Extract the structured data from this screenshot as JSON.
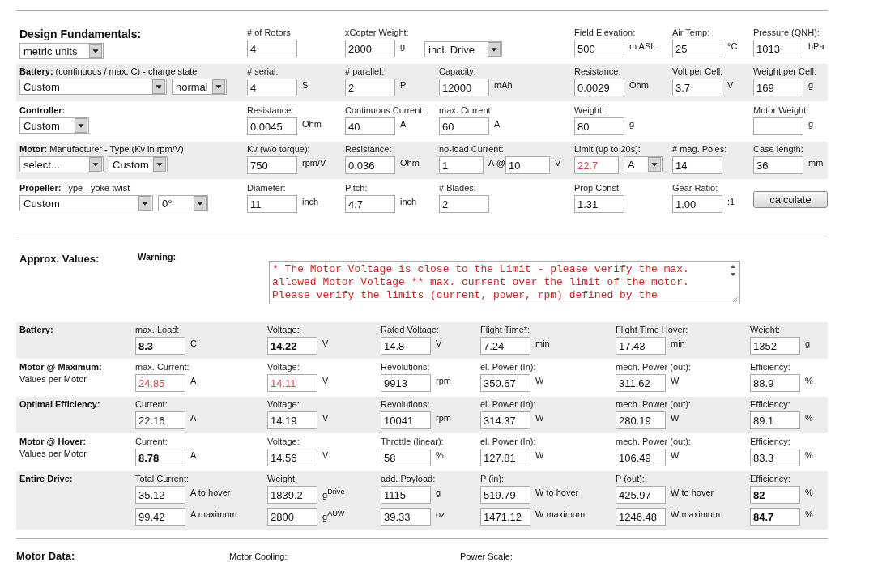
{
  "setup": {
    "rows": [
      {
        "kind": "title",
        "title": "Design Fundamentals:",
        "selects": [
          {
            "value": "metric units"
          }
        ],
        "cells": [
          {
            "label": "# of Rotors",
            "fields": [
              {
                "value": "4"
              }
            ]
          },
          {
            "label": "xCopter Weight:",
            "fields": [
              {
                "value": "2800",
                "unit": "g"
              }
            ]
          },
          {
            "kind": "select",
            "select": {
              "value": "incl. Drive"
            }
          },
          {
            "label": "Field Elevation:",
            "fields": [
              {
                "value": "500",
                "unit": "m ASL"
              }
            ]
          },
          {
            "label": "Air Temp:",
            "fields": [
              {
                "value": "25",
                "unit": "°C"
              }
            ]
          },
          {
            "label": "Pressure (QNH):",
            "fields": [
              {
                "value": "1013",
                "unit": "hPa"
              }
            ]
          }
        ]
      },
      {
        "kind": "row",
        "title": "Battery:",
        "subtitle": "(continuous / max. C) - charge state",
        "selects": [
          {
            "value": "Custom"
          },
          {
            "value": "normal"
          }
        ],
        "cells": [
          {
            "label": "# serial:",
            "fields": [
              {
                "value": "4",
                "unit": "S"
              }
            ]
          },
          {
            "label": "# parallel:",
            "fields": [
              {
                "value": "2",
                "unit": "P"
              }
            ]
          },
          {
            "label": "Capacity:",
            "fields": [
              {
                "value": "12000",
                "unit": "mAh"
              }
            ]
          },
          {
            "label": "Resistance:",
            "fields": [
              {
                "value": "0.0029",
                "unit": "Ohm"
              }
            ]
          },
          {
            "label": "Volt per Cell:",
            "fields": [
              {
                "value": "3.7",
                "unit": "V"
              }
            ]
          },
          {
            "label": "Weight per Cell:",
            "fields": [
              {
                "value": "169",
                "unit": "g"
              }
            ]
          }
        ]
      },
      {
        "kind": "row",
        "title": "Controller:",
        "selects": [
          {
            "value": "Custom"
          }
        ],
        "cells": [
          {
            "label": "Resistance:",
            "fields": [
              {
                "value": "0.0045",
                "unit": "Ohm"
              }
            ]
          },
          {
            "label": "Continuous Current:",
            "fields": [
              {
                "value": "40",
                "unit": "A"
              }
            ]
          },
          {
            "label": "max. Current:",
            "fields": [
              {
                "value": "60",
                "unit": "A"
              }
            ]
          },
          {
            "label": "Weight:",
            "fields": [
              {
                "value": "80",
                "unit": "g"
              }
            ]
          },
          "",
          {
            "label": "Motor Weight:",
            "fields": [
              {
                "unit": "g"
              }
            ]
          }
        ]
      },
      {
        "kind": "row",
        "title": "Motor:",
        "subtitle": "Manufacturer - Type (Kv in rpm/V)",
        "selects": [
          {
            "value": "select..."
          },
          {
            "value": "Custom"
          }
        ],
        "cells": [
          {
            "label": "Kv (w/o torque):",
            "fields": [
              {
                "value": "750",
                "unit": "rpm/V"
              }
            ]
          },
          {
            "label": "Resistance:",
            "fields": [
              {
                "value": "0.036",
                "unit": "Ohm"
              }
            ]
          },
          {
            "label": "no-load Current:",
            "fields": [
              {
                "value": "1",
                "unit": "A @"
              },
              {
                "value": "10",
                "unit": "V"
              }
            ]
          },
          {
            "label": "Limit (up to 20s):",
            "fields": [
              {
                "value": "22.7",
                "warn": true
              }
            ],
            "select": {
              "value": "A"
            }
          },
          {
            "label": "# mag. Poles:",
            "fields": [
              {
                "value": "14"
              }
            ]
          },
          {
            "label": "Case length:",
            "fields": [
              {
                "value": "36",
                "unit": "mm"
              }
            ]
          }
        ]
      },
      {
        "kind": "row",
        "title": "Propeller:",
        "subtitle": "Type - yoke twist",
        "selects": [
          {
            "value": "Custom"
          },
          {
            "value": "0°"
          }
        ],
        "cells": [
          {
            "label": "Diameter:",
            "fields": [
              {
                "value": "11",
                "unit": "inch"
              }
            ]
          },
          {
            "label": "Pitch:",
            "fields": [
              {
                "value": "4.7",
                "unit": "inch"
              }
            ]
          },
          {
            "label": "# Blades:",
            "fields": [
              {
                "value": "2"
              }
            ]
          },
          {
            "label": "Prop Const.",
            "fields": [
              {
                "value": "1.31"
              }
            ]
          },
          {
            "label": "Gear Ratio:",
            "fields": [
              {
                "value": "1.00",
                "unit": ":1"
              }
            ]
          },
          {
            "kind": "button",
            "label": "calculate"
          }
        ]
      }
    ]
  },
  "approx": {
    "title": "Approx. Values:",
    "warning_label": "Warning:",
    "warning_text": "* The Motor Voltage is close to the Limit - please verify the max. allowed Motor Voltage ** max. current over the limit of the motor. Please verify the limits (current, power, rpm) defined by the"
  },
  "results": [
    {
      "title": "Battery:",
      "cells": [
        {
          "label": "max. Load:",
          "lines": [
            {
              "value": "8.3",
              "unit": "C",
              "bold": true
            }
          ]
        },
        {
          "label": "Voltage:",
          "lines": [
            {
              "value": "14.22",
              "unit": "V",
              "bold": true
            }
          ]
        },
        {
          "label": "Rated Voltage:",
          "lines": [
            {
              "value": "14.8",
              "unit": "V"
            }
          ]
        },
        {
          "label": "Flight Time*:",
          "lines": [
            {
              "value": "7.24",
              "unit": "min"
            }
          ]
        },
        {
          "label": "Flight Time Hover:",
          "lines": [
            {
              "value": "17.43",
              "unit": "min"
            }
          ]
        },
        {
          "label": "Weight:",
          "lines": [
            {
              "value": "1352",
              "unit": "g"
            }
          ]
        }
      ]
    },
    {
      "title": "Motor @ Maximum:",
      "subtitle": "Values per Motor",
      "cells": [
        {
          "label": "max. Current:",
          "lines": [
            {
              "value": "24.85",
              "unit": "A",
              "warn": true
            }
          ]
        },
        {
          "label": "Voltage:",
          "lines": [
            {
              "value": "14.11",
              "unit": "V",
              "warn": true
            }
          ]
        },
        {
          "label": "Revolutions:",
          "lines": [
            {
              "value": "9913",
              "unit": "rpm"
            }
          ]
        },
        {
          "label": "el. Power (In):",
          "lines": [
            {
              "value": "350.67",
              "unit": "W"
            }
          ]
        },
        {
          "label": "mech. Power (out):",
          "lines": [
            {
              "value": "311.62",
              "unit": "W"
            }
          ]
        },
        {
          "label": "Efficiency:",
          "lines": [
            {
              "value": "88.9",
              "unit": "%"
            }
          ]
        }
      ]
    },
    {
      "title": "Optimal Efficiency:",
      "cells": [
        {
          "label": "Current:",
          "lines": [
            {
              "value": "22.16",
              "unit": "A"
            }
          ]
        },
        {
          "label": "Voltage:",
          "lines": [
            {
              "value": "14.19",
              "unit": "V"
            }
          ]
        },
        {
          "label": "Revolutions:",
          "lines": [
            {
              "value": "10041",
              "unit": "rpm"
            }
          ]
        },
        {
          "label": "el. Power (In):",
          "lines": [
            {
              "value": "314.37",
              "unit": "W"
            }
          ]
        },
        {
          "label": "mech. Power (out):",
          "lines": [
            {
              "value": "280.19",
              "unit": "W"
            }
          ]
        },
        {
          "label": "Efficiency:",
          "lines": [
            {
              "value": "89.1",
              "unit": "%"
            }
          ]
        }
      ]
    },
    {
      "title": "Motor @ Hover:",
      "subtitle": "Values per Motor",
      "cells": [
        {
          "label": "Current:",
          "lines": [
            {
              "value": "8.78",
              "unit": "A",
              "bold": true
            }
          ]
        },
        {
          "label": "Voltage:",
          "lines": [
            {
              "value": "14.56",
              "unit": "V"
            }
          ]
        },
        {
          "label": "Throttle (linear):",
          "lines": [
            {
              "value": "58",
              "unit": "%"
            }
          ]
        },
        {
          "label": "el. Power (In):",
          "lines": [
            {
              "value": "127.81",
              "unit": "W"
            }
          ]
        },
        {
          "label": "mech. Power (out):",
          "lines": [
            {
              "value": "106.49",
              "unit": "W"
            }
          ]
        },
        {
          "label": "Efficiency:",
          "lines": [
            {
              "value": "83.3",
              "unit": "%"
            }
          ]
        }
      ]
    },
    {
      "title": "Entire Drive:",
      "cells": [
        {
          "label": "Total Current:",
          "lines": [
            {
              "value": "35.12",
              "unit": "A to hover"
            },
            {
              "value": "99.42",
              "unit": "A maximum"
            }
          ]
        },
        {
          "label": "Weight:",
          "lines": [
            {
              "value": "1839.2",
              "unit": "g$^{Drive}$"
            },
            {
              "value": "2800",
              "unit": "g$^{AUW}$"
            }
          ]
        },
        {
          "label": "add. Payload:",
          "lines": [
            {
              "value": "1115",
              "unit": "g"
            },
            {
              "value": "39.33",
              "unit": "oz"
            }
          ]
        },
        {
          "label": "P (in):",
          "lines": [
            {
              "value": "519.79",
              "unit": "W to hover"
            },
            {
              "value": "1471.12",
              "unit": "W maximum"
            }
          ]
        },
        {
          "label": "P (out):",
          "lines": [
            {
              "value": "425.97",
              "unit": "W to hover"
            },
            {
              "value": "1246.48",
              "unit": "W maximum"
            }
          ]
        },
        {
          "label": "Efficiency:",
          "lines": [
            {
              "value": "82",
              "unit": "%",
              "bold": true
            },
            {
              "value": "84.7",
              "unit": "%",
              "bold": true
            }
          ]
        }
      ]
    }
  ],
  "footer": {
    "title": "Motor Data:",
    "labels": [
      "Motor Cooling:",
      "Power Scale:"
    ]
  }
}
